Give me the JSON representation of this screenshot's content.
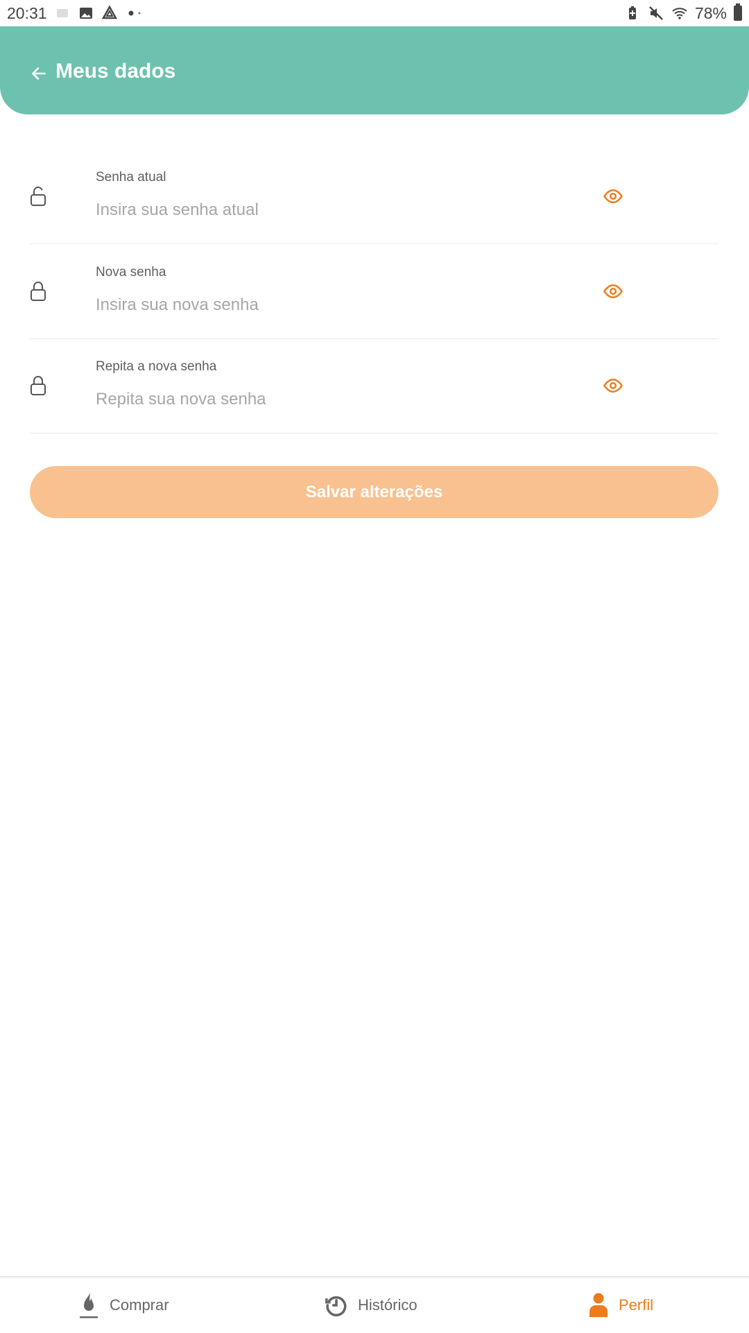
{
  "status_bar": {
    "time": "20:31",
    "battery": "78%",
    "left_icons": [
      "notification-icon",
      "gallery-icon",
      "drive-icon",
      "dot-icon"
    ],
    "right_icons": [
      "battery-saver-icon",
      "mute-icon",
      "wifi-icon",
      "battery-icon"
    ]
  },
  "header": {
    "title": "Meus dados",
    "background_color": "#6cc2ae"
  },
  "form": {
    "fields": [
      {
        "label": "Senha atual",
        "placeholder": "Insira sua senha atual",
        "value": ""
      },
      {
        "label": "Nova senha",
        "placeholder": "Insira sua nova senha",
        "value": ""
      },
      {
        "label": "Repita a nova senha",
        "placeholder": "Repita sua nova senha",
        "value": ""
      }
    ],
    "save_label": "Salvar alterações",
    "save_color": "#f8c18f",
    "accent_color": "#ee7b1c"
  },
  "bottom_nav": {
    "items": [
      {
        "label": "Comprar",
        "icon": "flame-icon",
        "active": false
      },
      {
        "label": "Histórico",
        "icon": "history-icon",
        "active": false
      },
      {
        "label": "Perfil",
        "icon": "person-icon",
        "active": true
      }
    ]
  }
}
